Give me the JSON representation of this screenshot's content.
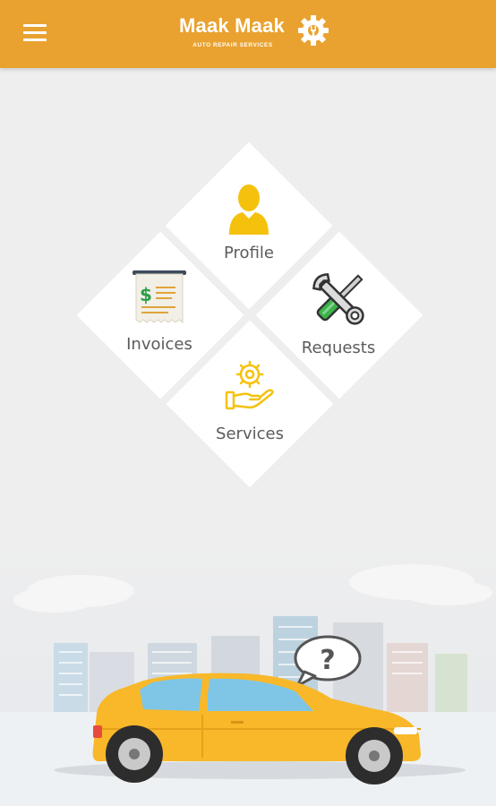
{
  "app": {
    "title": "Maak Maak",
    "subtitle": "AUTO REPAIR SERVICES"
  },
  "header": {
    "menu_icon": "hamburger-menu-icon",
    "logo_icon": "gear-wrench-icon",
    "background_color": "#e9a230"
  },
  "menu": {
    "profile": {
      "label": "Profile",
      "icon": "user-icon"
    },
    "invoices": {
      "label": "Invoices",
      "icon": "receipt-dollar-icon"
    },
    "requests": {
      "label": "Requests",
      "icon": "wrench-screwdriver-icon"
    },
    "services": {
      "label": "Services",
      "icon": "hand-gear-icon"
    }
  },
  "illustration": {
    "subject": "yellow-car-city-scene",
    "bubble_icon": "question-mark-icon"
  },
  "colors": {
    "accent": "#e9a230",
    "icon_yellow": "#f4c20d",
    "car_yellow": "#f8b82a",
    "label_gray": "#5b5b5b"
  }
}
